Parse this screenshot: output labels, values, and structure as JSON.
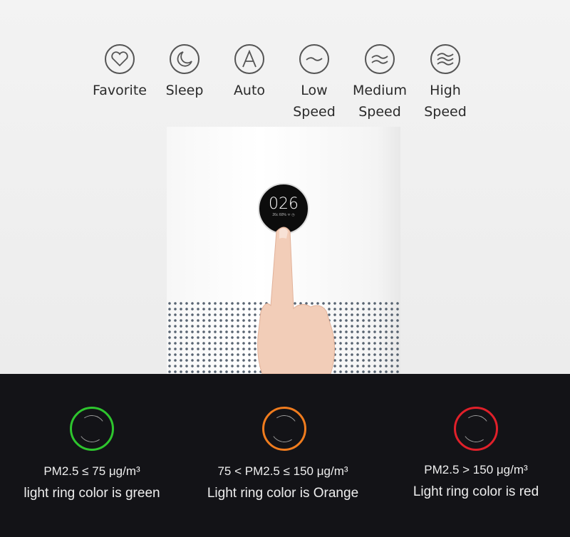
{
  "modes": [
    {
      "icon": "heart-icon",
      "label1": "Favorite",
      "label2": ""
    },
    {
      "icon": "moon-icon",
      "label1": "Sleep",
      "label2": ""
    },
    {
      "icon": "auto-a-icon",
      "label1": "Auto",
      "label2": ""
    },
    {
      "icon": "single-wave-icon",
      "label1": "Low",
      "label2": "Speed"
    },
    {
      "icon": "double-wave-icon",
      "label1": "Medium",
      "label2": "Speed"
    },
    {
      "icon": "triple-wave-icon",
      "label1": "High",
      "label2": "Speed"
    }
  ],
  "display": {
    "pm_value": "026",
    "status": "26c 60% ᯤ ◷"
  },
  "rings": [
    {
      "color": "#2ec52e",
      "condition": "PM2.5 ≤ 75 μg/m³",
      "description": "light ring color is green"
    },
    {
      "color": "#f07c1e",
      "condition": "75 < PM2.5 ≤ 150 μg/m³",
      "description": "Light ring color is Orange"
    },
    {
      "color": "#e0202a",
      "condition": "PM2.5 > 150 μg/m³",
      "description": "Light ring color is red"
    }
  ]
}
